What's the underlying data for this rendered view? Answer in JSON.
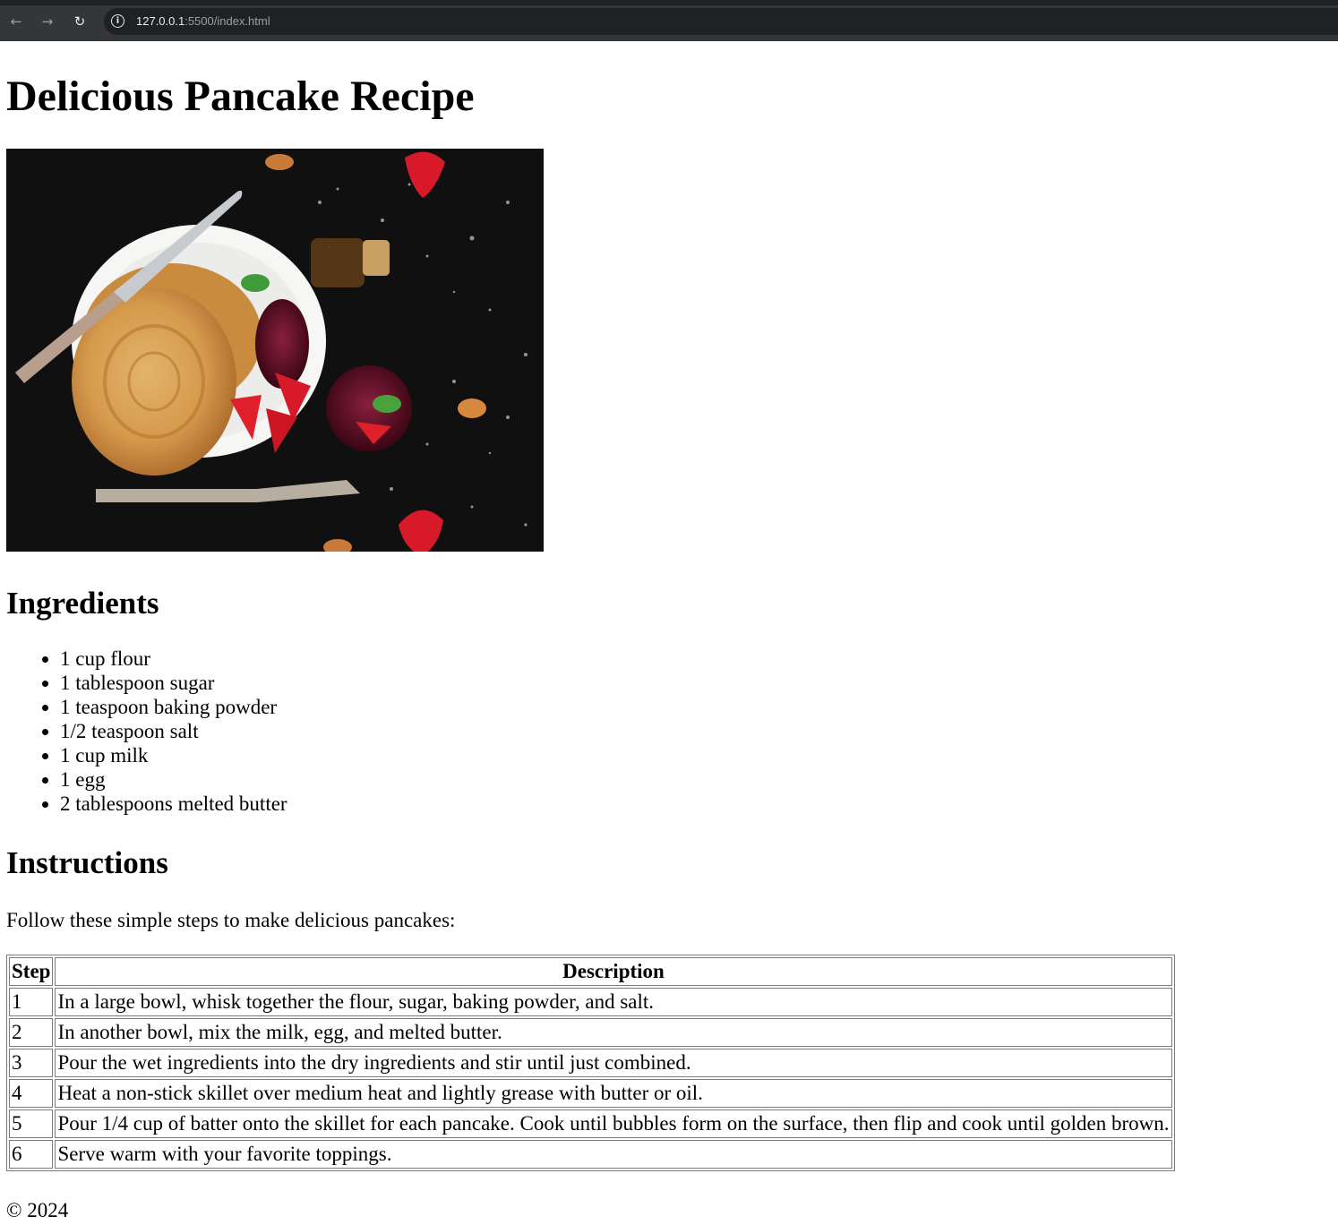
{
  "browser": {
    "back_icon": "←",
    "forward_icon": "→",
    "reload_icon": "↻",
    "info_icon": "i",
    "url_host": "127.0.0.1",
    "url_rest": ":5500/index.html"
  },
  "page": {
    "title": "Delicious Pancake Recipe",
    "ingredients_heading": "Ingredients",
    "ingredients": [
      "1 cup flour",
      "1 tablespoon sugar",
      "1 teaspoon baking powder",
      "1/2 teaspoon salt",
      "1 cup milk",
      "1 egg",
      "2 tablespoons melted butter"
    ],
    "instructions_heading": "Instructions",
    "instructions_intro": "Follow these simple steps to make delicious pancakes:",
    "table": {
      "headers": [
        "Step",
        "Description"
      ],
      "rows": [
        [
          "1",
          "In a large bowl, whisk together the flour, sugar, baking powder, and salt."
        ],
        [
          "2",
          "In another bowl, mix the milk, egg, and melted butter."
        ],
        [
          "3",
          "Pour the wet ingredients into the dry ingredients and stir until just combined."
        ],
        [
          "4",
          "Heat a non-stick skillet over medium heat and lightly grease with butter or oil."
        ],
        [
          "5",
          "Pour 1/4 cup of batter onto the skillet for each pancake. Cook until bubbles form on the surface, then flip and cook until golden brown."
        ],
        [
          "6",
          "Serve warm with your favorite toppings."
        ]
      ]
    },
    "footer": "© 2024"
  }
}
